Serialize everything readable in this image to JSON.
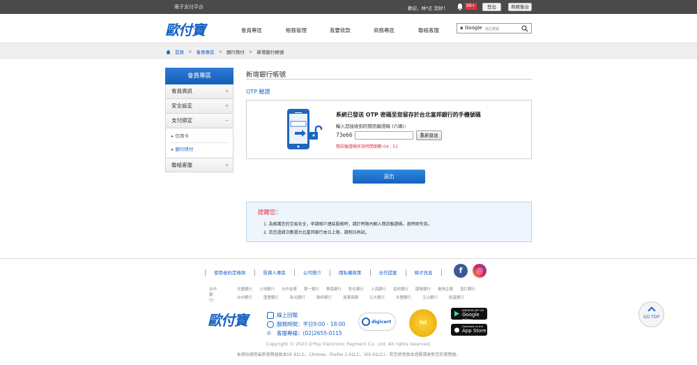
{
  "topbar": {
    "site_name": "電子支付平台",
    "welcome": "歡迎，林*正 您好！",
    "badge": "99+",
    "logout": "登出",
    "merchant": "商務後台"
  },
  "header": {
    "logo": "歐付寶",
    "nav": [
      "會員專區",
      "帳務管理",
      "我要收款",
      "商務專區",
      "聯絡客服"
    ],
    "search_brand": "Google",
    "search_hint": "自訂搜尋"
  },
  "breadcrumb": [
    "首頁",
    "會員專區",
    "銀行快付",
    "新增銀行帳號"
  ],
  "sidebar": {
    "title": "會員專區",
    "items": [
      {
        "label": "會員資訊",
        "sign": "+"
      },
      {
        "label": "安全設定",
        "sign": "+"
      },
      {
        "label": "支付綁定",
        "sign": "−"
      }
    ],
    "sub": [
      "信用卡",
      "銀行快付"
    ],
    "last": {
      "label": "聯絡客服",
      "sign": "+"
    }
  },
  "main": {
    "title": "新增銀行帳號",
    "otp_label": "OTP 驗證",
    "otp_message": "系統已發送 OTP 密碼至您留存於台北富邦銀行的手機號碼",
    "otp_instruction": "輸入您接收到的簡訊驗證碼 (六碼)：",
    "otp_prefix": "73e66 -",
    "otp_value": "",
    "resend": "重新發送",
    "timer": "簡訊驗證碼有效時間倒數 04 : 51",
    "submit": "送出"
  },
  "reminder": {
    "title": "提醒您：",
    "items": [
      "1. 為維護您的交易安全，申請帳戶連結服務時，請於時限內輸入簡訊驗證碼，逾時即失效。",
      "2. 若您過錯次數還台北富邦銀行本日上限，請明日再試。"
    ]
  },
  "footer": {
    "links": [
      "使用者約定條款",
      "投資人專區",
      "公司簡介",
      "隱私權政策",
      "合作提案",
      "徵才訊息"
    ],
    "partners_label": "合作銀行：",
    "partners": [
      "兆豐銀行",
      "土地銀行",
      "合作金庫",
      "第一銀行",
      "華南銀行",
      "彰化銀行",
      "上海銀行",
      "富邦銀行",
      "國泰銀行",
      "臺灣企銀",
      "渣打銀行",
      "台中銀行",
      "匯豐銀行",
      "新光銀行",
      "聯邦銀行",
      "遠東商銀",
      "元大銀行",
      "永豐銀行",
      "玉山銀行",
      "凱基銀行"
    ],
    "logo": "歐付寶",
    "contact": [
      "線上回報",
      "服務時間：平日9:00 - 18:00",
      "客服專線：(02)2655-0115"
    ],
    "digicert": "digicert",
    "badge": "list",
    "google_play_small": "ANDROID APP ON",
    "google_play": "Google play",
    "app_store_small": "Download on the",
    "app_store": "App Store",
    "copyright": "Copyright © 2023 O'Pay Electronic Payment Co., Ltd. All rights reserved.",
    "browser": "本網站適用最新瀏覽器版本(IE 8以上、Chrome、Firefox 2.0以上、iOS 6以上)，若您使用版本過舊請更新您的瀏覽器。",
    "gotop": "GO TOP"
  },
  "colors": {
    "accent": "#1662c4",
    "alert": "#d9333f",
    "topbar": "#4a4a4a"
  }
}
